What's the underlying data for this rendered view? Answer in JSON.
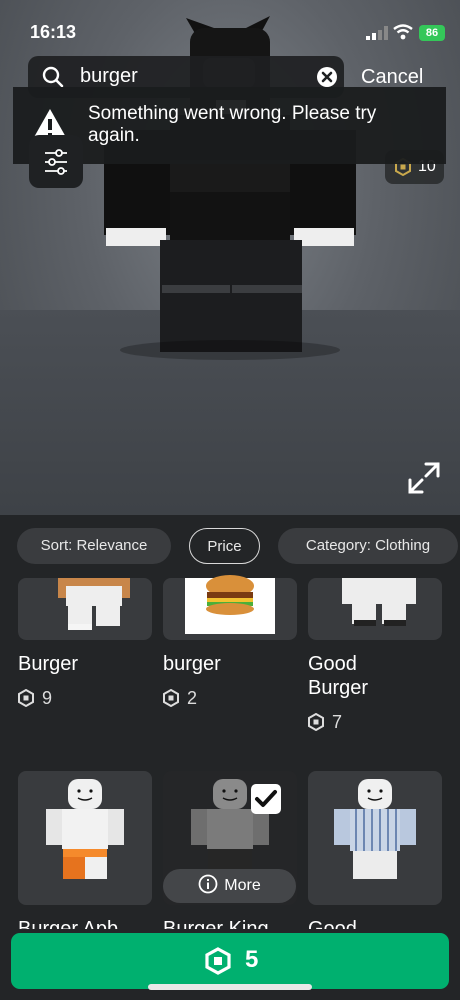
{
  "status": {
    "time": "16:13",
    "battery": "86"
  },
  "search": {
    "query": "burger",
    "cancel_label": "Cancel"
  },
  "error": {
    "message": "Something went wrong. Please try again."
  },
  "avatar_price_badge": "10",
  "filters": {
    "sort": "Sort: Relevance",
    "price": "Price",
    "category": "Category: Clothing"
  },
  "items": [
    {
      "name": "Burger",
      "price": "9"
    },
    {
      "name": "burger",
      "price": "2"
    },
    {
      "name": "Good Burger",
      "price": "7"
    },
    {
      "name": "Burger Apb...",
      "price": ""
    },
    {
      "name": "Burger King",
      "price": ""
    },
    {
      "name": "Good",
      "price": ""
    }
  ],
  "more_label": "More",
  "buy": {
    "price": "5"
  },
  "colors": {
    "accent": "#00b06f",
    "battery": "#34c759"
  }
}
